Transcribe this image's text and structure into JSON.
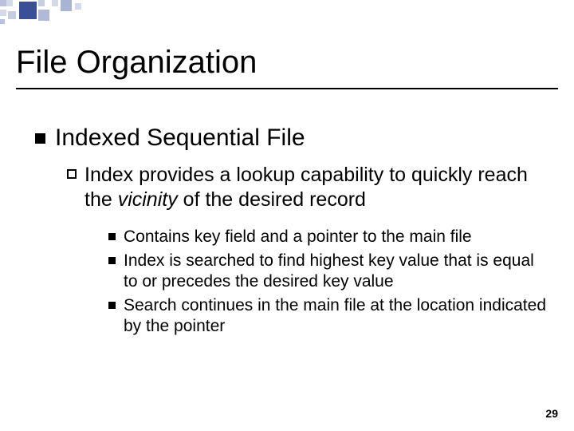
{
  "title": "File Organization",
  "level1": {
    "text": "Indexed Sequential File"
  },
  "level2": {
    "prefix": "Index",
    "rest": " provides a lookup capability to quickly reach the ",
    "italic": "vicinity",
    "suffix": " of the desired record"
  },
  "level3": {
    "items": [
      "Contains key field and a pointer to the main file",
      "Index is searched to find highest key value that is equal to or precedes the desired key value",
      "Search continues in the main file at the location indicated by the pointer"
    ]
  },
  "page_number": "29"
}
